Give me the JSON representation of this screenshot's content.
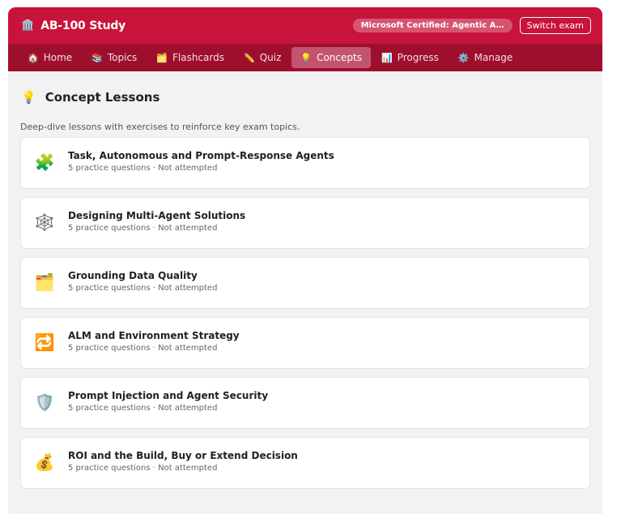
{
  "header": {
    "icon": "bank-building-icon",
    "title": "AB-100 Study",
    "cert_badge": "Microsoft Certified: Agentic AI Business Solutions Architect",
    "switch_label": "Switch exam"
  },
  "nav": {
    "items": [
      {
        "label": "Home",
        "icon": "house-icon"
      },
      {
        "label": "Topics",
        "icon": "books-icon"
      },
      {
        "label": "Flashcards",
        "icon": "card-index-icon"
      },
      {
        "label": "Quiz",
        "icon": "pencil-icon"
      },
      {
        "label": "Concepts",
        "icon": "light-bulb-icon"
      },
      {
        "label": "Progress",
        "icon": "bar-chart-icon"
      },
      {
        "label": "Manage",
        "icon": "gear-icon"
      }
    ],
    "active": "Concepts"
  },
  "page": {
    "title_icon": "light-bulb-icon",
    "title": "Concept Lessons",
    "subtitle": "Deep-dive lessons with exercises to reinforce key exam topics."
  },
  "lessons": [
    {
      "icon": "puzzle-piece-icon",
      "title": "Task, Autonomous and Prompt-Response Agents",
      "meta": "5 practice questions · Not attempted"
    },
    {
      "icon": "spider-web-icon",
      "title": "Designing Multi-Agent Solutions",
      "meta": "5 practice questions · Not attempted"
    },
    {
      "icon": "folder-icon",
      "title": "Grounding Data Quality",
      "meta": "5 practice questions · Not attempted"
    },
    {
      "icon": "repeat-arrows-icon",
      "title": "ALM and Environment Strategy",
      "meta": "5 practice questions · Not attempted"
    },
    {
      "icon": "shield-icon",
      "title": "Prompt Injection and Agent Security",
      "meta": "5 practice questions · Not attempted"
    },
    {
      "icon": "money-bag-icon",
      "title": "ROI and the Build, Buy or Extend Decision",
      "meta": "5 practice questions · Not attempted"
    }
  ],
  "colors": {
    "topbar": "#c8133a",
    "navbar": "#9e0f2e",
    "nav_active": "#c2556d",
    "page_bg": "#f2f2f2"
  }
}
